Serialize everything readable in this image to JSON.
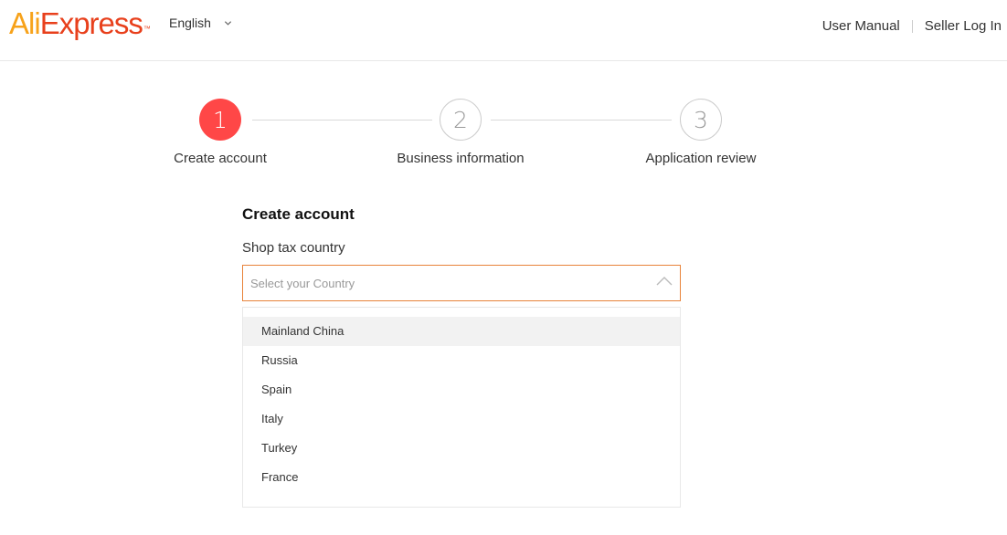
{
  "header": {
    "logo": {
      "part1": "Ali",
      "part2": "Express",
      "trademark": "™"
    },
    "language": "English",
    "language_icon": "chevron-down-icon",
    "links": {
      "user_manual": "User Manual",
      "seller_login": "Seller Log In"
    }
  },
  "steps": [
    {
      "number": "1",
      "label": "Create account",
      "state": "active"
    },
    {
      "number": "2",
      "label": "Business information",
      "state": "inactive"
    },
    {
      "number": "3",
      "label": "Application review",
      "state": "inactive"
    }
  ],
  "form": {
    "title": "Create account",
    "country_label": "Shop tax country",
    "country_select": {
      "placeholder": "Select your Country",
      "expanded": true,
      "icon": "chevron-up-icon",
      "options": [
        "Mainland China",
        "Russia",
        "Spain",
        "Italy",
        "Turkey",
        "France"
      ],
      "highlighted_option": "Mainland China"
    }
  },
  "colors": {
    "accent_red": "#ff4747",
    "select_border": "#e8833a",
    "logo_orange": "#f7a21a",
    "logo_red": "#e8401c"
  }
}
